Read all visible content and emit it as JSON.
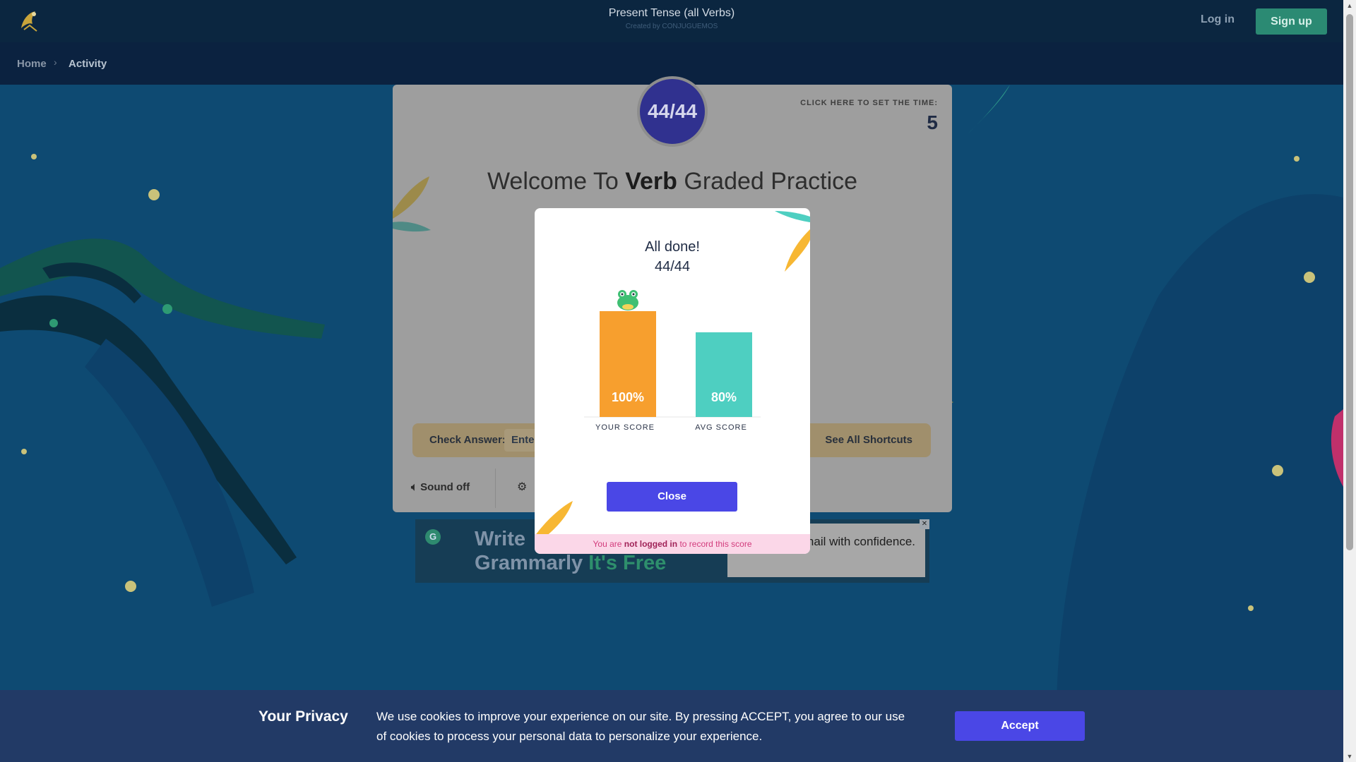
{
  "header": {
    "title": "Present Tense (all Verbs)",
    "subtitle": "Created by CONJUGUEMOS",
    "login_label": "Log in",
    "signup_label": "Sign up"
  },
  "breadcrumb": {
    "home": "Home",
    "current": "Activity"
  },
  "activity": {
    "score_circle": "44/44",
    "timer_label": "CLICK HERE TO SET THE TIME:",
    "timer_value": "5",
    "welcome_prefix": "Welcome To",
    "welcome_bold": "Verb",
    "welcome_suffix": "Graded Practice",
    "check_label": "Check Answer:",
    "check_input_value": "Ente",
    "shortcuts_label": "See All Shortcuts",
    "sound_label": "Sound off"
  },
  "modal": {
    "title": "All done!",
    "score": "44/44",
    "close_label": "Close",
    "warning_prefix": "You are",
    "warning_bold": "not logged in",
    "warning_suffix": "to record this score"
  },
  "chart_data": {
    "type": "bar",
    "categories": [
      "YOUR SCORE",
      "AVG SCORE"
    ],
    "values": [
      100,
      80
    ],
    "value_labels": [
      "100%",
      "80%"
    ],
    "ylim": [
      0,
      100
    ],
    "colors": [
      "#f79f2e",
      "#4ecfc1"
    ]
  },
  "ad": {
    "line1": "Write",
    "line2": "Grammarly",
    "line2_highlight": "It's Free",
    "side_text": "nail with confidence.",
    "logo": "G"
  },
  "privacy": {
    "title": "Your Privacy",
    "text": "We use cookies to improve your experience on our site. By pressing ACCEPT, you agree to our use of cookies to process your personal data to personalize your experience.",
    "accept_label": "Accept"
  },
  "colors": {
    "topbar": "#0b2640",
    "accent": "#4a47e6",
    "signup": "#2b8a73",
    "score_circle": "#30318f"
  }
}
